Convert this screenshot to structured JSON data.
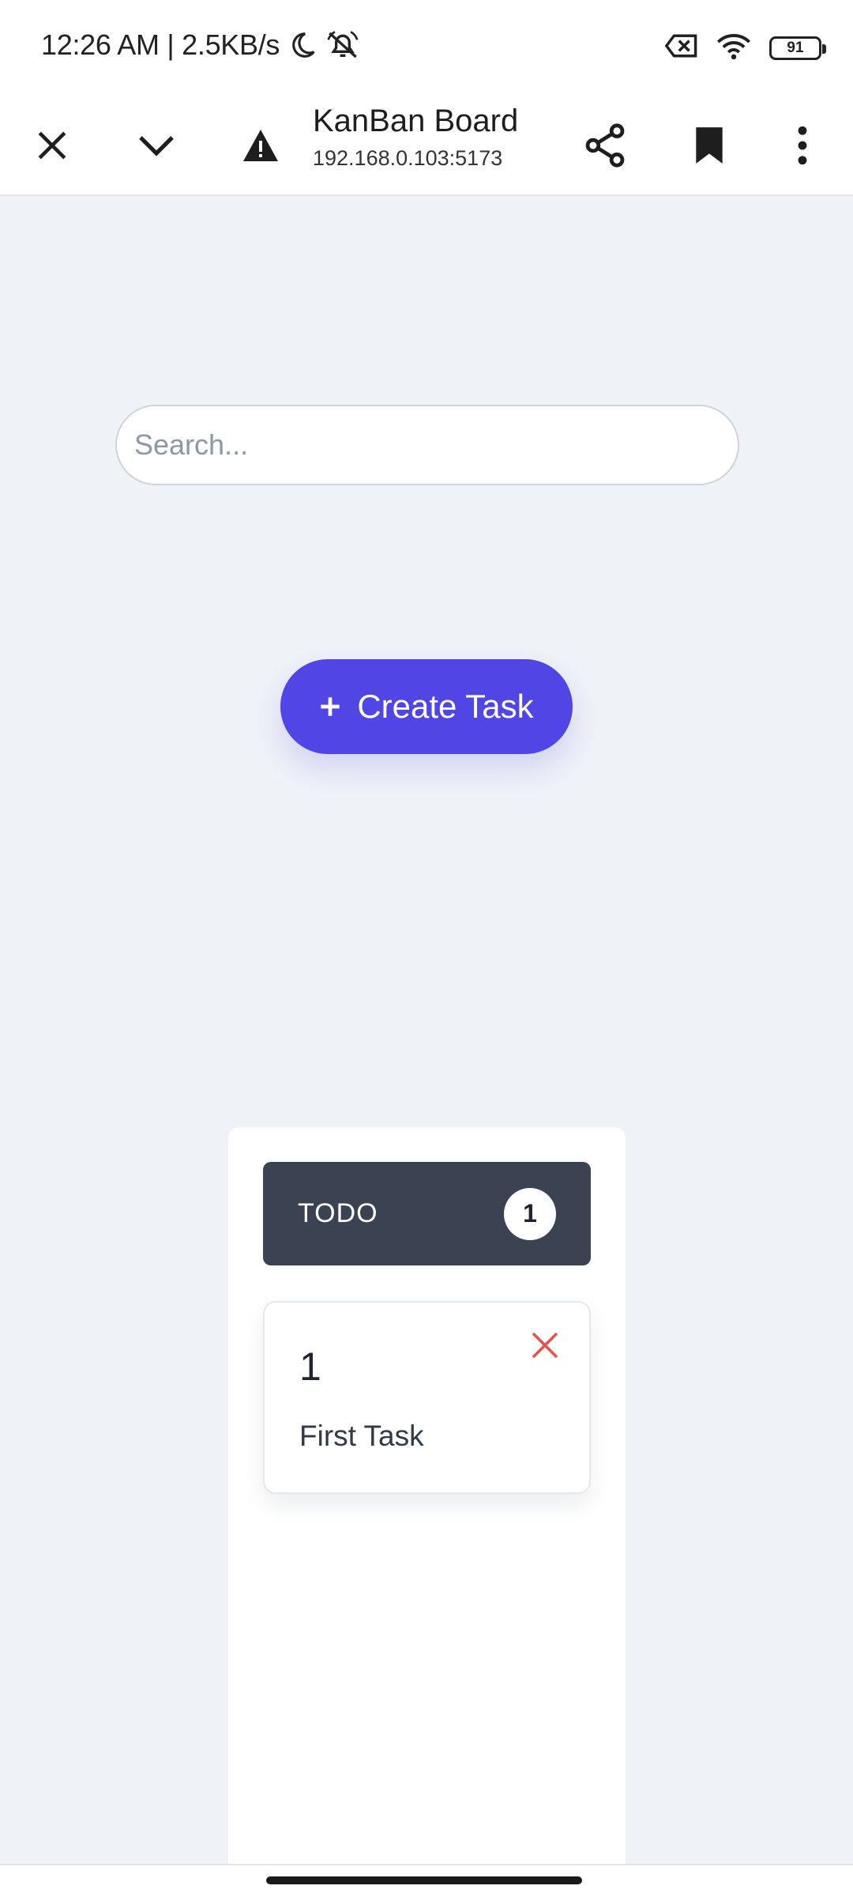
{
  "status_bar": {
    "time_speed": "12:26 AM | 2.5KB/s",
    "battery": "91",
    "icons": [
      "moon-icon",
      "bell-off-icon",
      "sim-off-icon",
      "wifi-icon",
      "battery-icon"
    ]
  },
  "browser": {
    "page_title": "KanBan Board",
    "url": "192.168.0.103:5173",
    "icons": [
      "close-icon",
      "chevron-down-icon",
      "warning-icon",
      "share-icon",
      "bookmark-icon",
      "more-vert-icon"
    ]
  },
  "search": {
    "placeholder": "Search...",
    "value": ""
  },
  "create_button": {
    "label": "Create Task",
    "icon": "plus-icon",
    "color": "#4f46e5"
  },
  "board": {
    "columns": [
      {
        "title": "TODO",
        "count": "1",
        "header_color": "#3b4252",
        "tasks": [
          {
            "id": "1",
            "title": "First Task",
            "delete_icon": "close-icon",
            "delete_color": "#e5534b"
          }
        ]
      }
    ]
  }
}
